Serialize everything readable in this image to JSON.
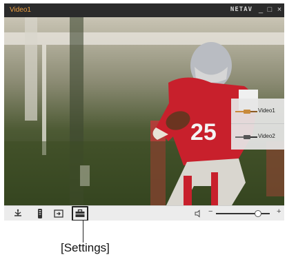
{
  "window": {
    "title": "Video1",
    "brand": "NETAV",
    "controls": {
      "minimize": "_",
      "maximize": "□",
      "close": "×"
    }
  },
  "source_panel": {
    "items": [
      {
        "label": "Video1",
        "cable_color": "#c8893a",
        "icon": "video-cable-icon"
      },
      {
        "label": "Video2",
        "cable_color": "#6a6a6a",
        "icon": "video-cable-icon"
      }
    ]
  },
  "toolbar": {
    "buttons": [
      {
        "icon": "tv-antenna-icon"
      },
      {
        "icon": "remote-control-icon"
      },
      {
        "icon": "input-switch-icon"
      },
      {
        "icon": "settings-toolbox-icon"
      }
    ],
    "volume": {
      "minus": "−",
      "plus": "+",
      "level": 0.77
    }
  },
  "callout": {
    "label": "[Settings]"
  }
}
